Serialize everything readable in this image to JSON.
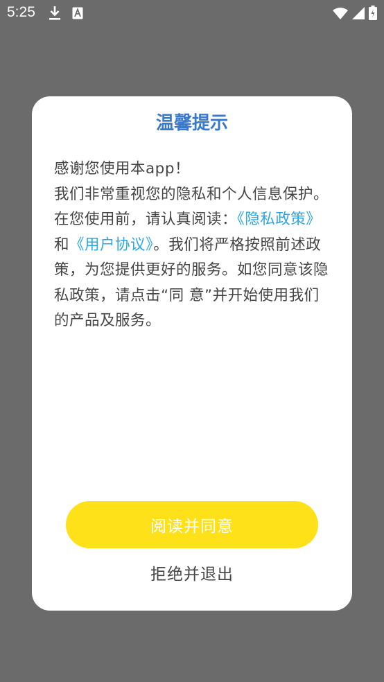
{
  "status_bar": {
    "time": "5:25",
    "left_icons": [
      "download-icon",
      "a-notification-icon"
    ],
    "right_icons": [
      "wifi-icon",
      "signal-icon",
      "battery-icon"
    ]
  },
  "dialog": {
    "title": "温馨提示",
    "greeting": "感谢您使用本app！",
    "para_part1": " 我们非常重视您的隐私和个人信息保护。在您使用前，请认真阅读：",
    "privacy_link": "《隐私政策》",
    "and_text": "和",
    "agreement_link": "《用户协议》",
    "para_part2": "。我们将严格按照前述政策，为您提供更好的服务。如您同意该隐私政策，请点击“同 意”并开始使用我们的产品及服务。",
    "agree_label": "阅读并同意",
    "reject_label": "拒绝并退出"
  },
  "colors": {
    "overlay": "#6b6b6b",
    "title": "#3a78c9",
    "link": "#2aa7e8",
    "agree_button": "#ffe11a",
    "body_text": "#444444"
  }
}
